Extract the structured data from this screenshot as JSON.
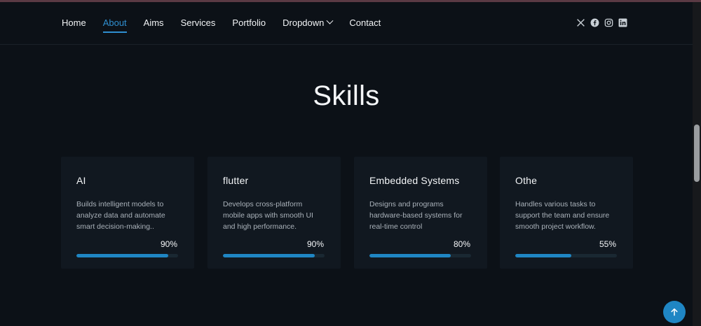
{
  "nav": {
    "items": [
      {
        "label": "Home",
        "active": false
      },
      {
        "label": "About",
        "active": true
      },
      {
        "label": "Aims",
        "active": false
      },
      {
        "label": "Services",
        "active": false
      },
      {
        "label": "Portfolio",
        "active": false
      },
      {
        "label": "Dropdown",
        "active": false,
        "has_dropdown": true
      },
      {
        "label": "Contact",
        "active": false
      }
    ],
    "social_icons": [
      "x-twitter-icon",
      "facebook-icon",
      "instagram-icon",
      "linkedin-icon"
    ]
  },
  "section": {
    "title": "Skills"
  },
  "skills": [
    {
      "title": "AI",
      "description": "Builds intelligent models to analyze data and automate smart decision-making..",
      "percent_label": "90%",
      "percent": 90
    },
    {
      "title": "flutter",
      "description": "Develops cross-platform mobile apps with smooth UI and high performance.",
      "percent_label": "90%",
      "percent": 90
    },
    {
      "title": "Embedded Systems",
      "description": "Designs and programs hardware-based systems for real-time control",
      "percent_label": "80%",
      "percent": 80
    },
    {
      "title": "Othe",
      "description": "Handles various tasks to support the team and ensure smooth project workflow.",
      "percent_label": "55%",
      "percent": 55
    }
  ],
  "colors": {
    "background": "#0c1117",
    "card": "#111820",
    "accent": "#1f86c4",
    "active_nav": "#2f8fd0"
  },
  "back_to_top_icon": "arrow-up-icon"
}
